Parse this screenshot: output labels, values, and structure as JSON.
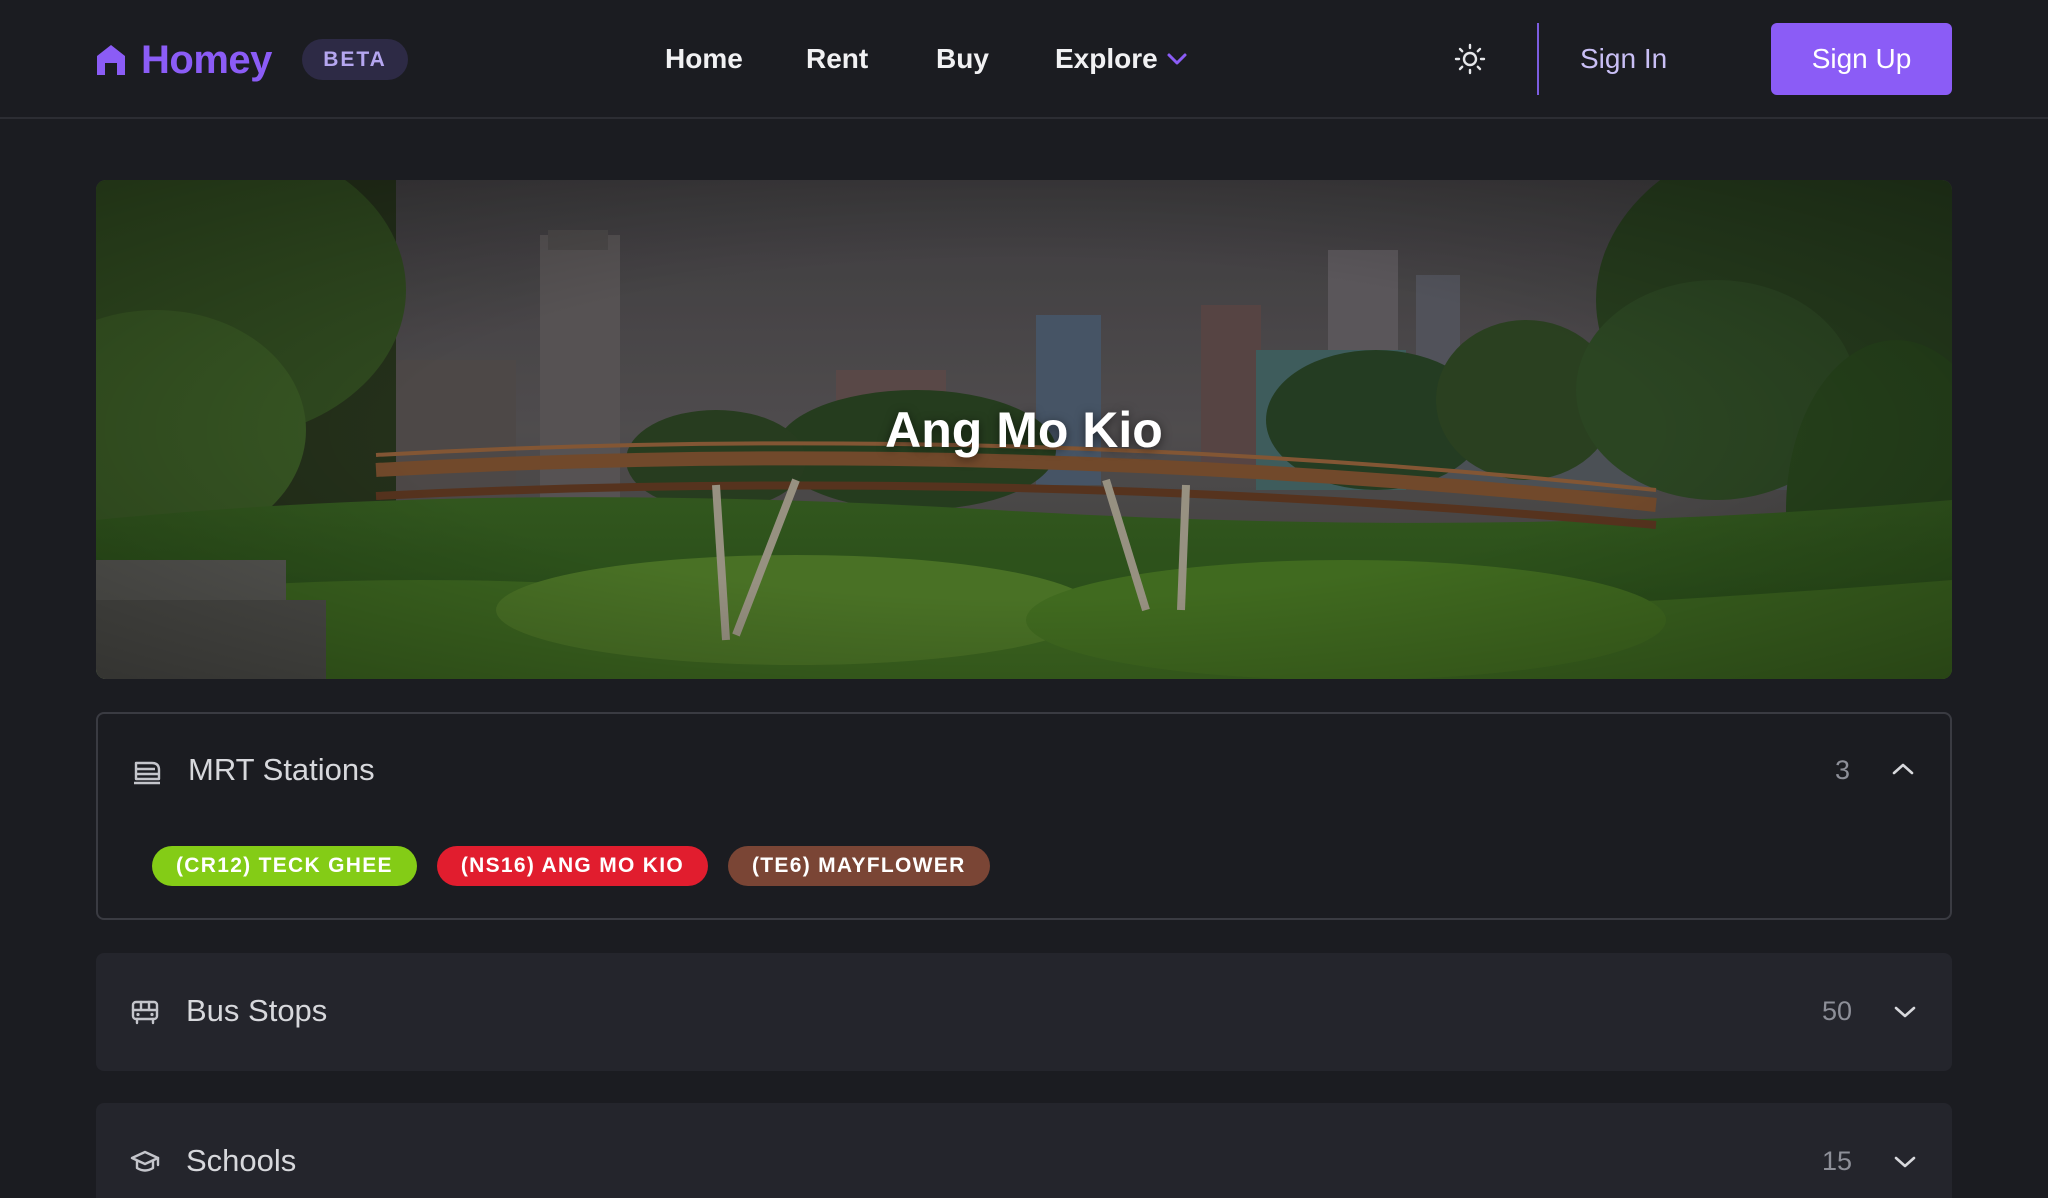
{
  "brand": {
    "name": "Homey",
    "badge": "BETA",
    "accent_color": "#8b5cf6"
  },
  "nav": {
    "items": [
      {
        "label": "Home"
      },
      {
        "label": "Rent"
      },
      {
        "label": "Buy"
      },
      {
        "label": "Explore",
        "icon": "chevron-down-icon"
      }
    ]
  },
  "header_actions": {
    "theme_toggle_icon": "sun-icon",
    "sign_in": "Sign In",
    "sign_up": "Sign Up"
  },
  "hero": {
    "title": "Ang Mo Kio"
  },
  "sections": [
    {
      "title": "MRT Stations",
      "icon": "train-icon",
      "count": "3",
      "expanded": true,
      "stations": [
        {
          "label": "(CR12) TECK GHEE",
          "color": "#84cc16"
        },
        {
          "label": "(NS16) ANG MO KIO",
          "color": "#e11d2e"
        },
        {
          "label": "(TE6) MAYFLOWER",
          "color": "#7a4535"
        }
      ]
    },
    {
      "title": "Bus Stops",
      "icon": "bus-icon",
      "count": "50",
      "expanded": false
    },
    {
      "title": "Schools",
      "icon": "graduation-cap-icon",
      "count": "15",
      "expanded": false
    }
  ]
}
